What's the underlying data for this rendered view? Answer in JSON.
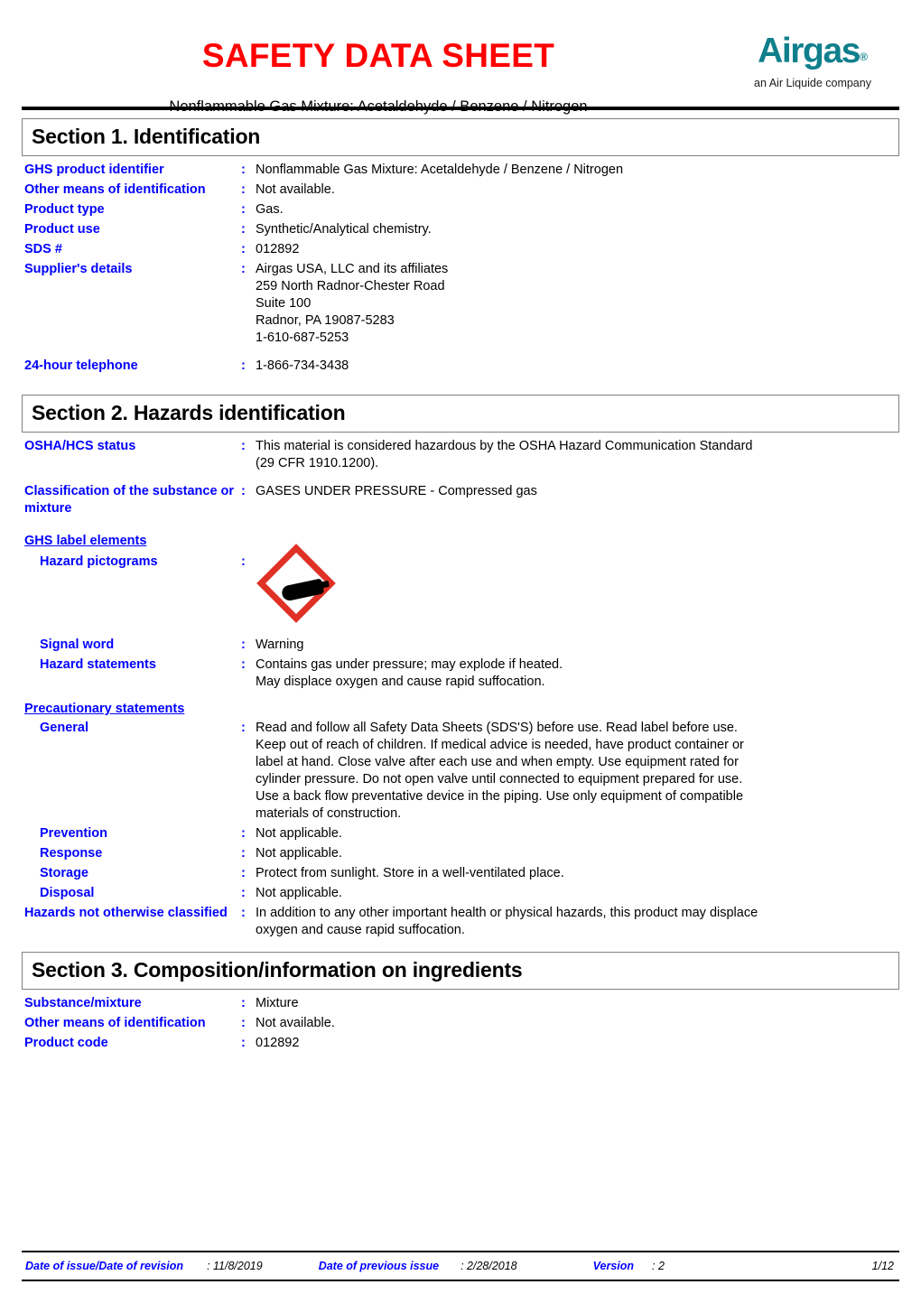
{
  "header": {
    "title": "SAFETY DATA SHEET",
    "subtitle": "Nonflammable Gas Mixture:  Acetaldehyde / Benzene / Nitrogen",
    "logo_word": "Airgas",
    "logo_mark": "®",
    "logo_tagline": "an Air Liquide company",
    "brand_color": "#0f7f8c",
    "title_color": "#ff0000"
  },
  "colon": ":",
  "section1": {
    "heading": "Section 1. Identification",
    "rows": [
      {
        "label": "GHS product identifier",
        "value": "Nonflammable Gas Mixture:  Acetaldehyde / Benzene / Nitrogen"
      },
      {
        "label": "Other means of\nidentification",
        "value": "Not available."
      },
      {
        "label": "Product type",
        "value": "Gas."
      },
      {
        "label": "Product use",
        "value": "Synthetic/Analytical chemistry."
      },
      {
        "label": "SDS #",
        "value": "012892"
      },
      {
        "label": "Supplier's details",
        "value": "Airgas USA, LLC and its affiliates\n259 North Radnor-Chester Road\nSuite 100\nRadnor, PA 19087-5283\n1-610-687-5253"
      },
      {
        "label": "24-hour telephone",
        "value": "1-866-734-3438"
      }
    ]
  },
  "section2": {
    "heading": "Section 2. Hazards identification",
    "osha_label": "OSHA/HCS status",
    "osha_value": "This material is considered hazardous by the OSHA Hazard Communication Standard\n(29 CFR 1910.1200).",
    "classification_label": "Classification of the\nsubstance or mixture",
    "classification_value": "GASES UNDER PRESSURE - Compressed gas",
    "ghs_label_elements": "GHS label elements",
    "pictograms_label": "Hazard pictograms",
    "pictogram_name": "gas-cylinder-pictogram",
    "signal_word_label": "Signal word",
    "signal_word_value": "Warning",
    "hazard_statements_label": "Hazard statements",
    "hazard_statements_value": "Contains gas under pressure; may explode if heated.\nMay displace oxygen and cause rapid suffocation.",
    "precautionary_heading": "Precautionary statements",
    "precautionary": [
      {
        "label": "General",
        "value": "Read and follow all Safety Data Sheets (SDS'S) before use.  Read label before use.\nKeep out of reach of children.  If medical advice is needed, have product container or\nlabel at hand.  Close valve after each use and when empty.  Use equipment rated for\ncylinder pressure.  Do not open valve until connected to equipment prepared for use.\nUse a back flow preventative device in the piping.  Use only equipment of compatible\nmaterials of construction."
      },
      {
        "label": "Prevention",
        "value": "Not applicable."
      },
      {
        "label": "Response",
        "value": "Not applicable."
      },
      {
        "label": "Storage",
        "value": "Protect from sunlight.  Store in a well-ventilated place."
      },
      {
        "label": "Disposal",
        "value": "Not applicable."
      }
    ],
    "hnoc_label": "Hazards not otherwise\nclassified",
    "hnoc_value": "In addition to any other important health or physical hazards, this product may displace\noxygen and cause rapid suffocation."
  },
  "section3": {
    "heading": "Section 3. Composition/information on ingredients",
    "rows": [
      {
        "label": "Substance/mixture",
        "value": "Mixture"
      },
      {
        "label": "Other means of\nidentification",
        "value": "Not available."
      },
      {
        "label": "Product code",
        "value": "012892"
      }
    ]
  },
  "footer": {
    "issue_label": "Date of issue/Date of revision",
    "issue_value": ": 11/8/2019",
    "previous_label": "Date of previous issue",
    "previous_value": ": 2/28/2018",
    "version_label": "Version",
    "version_value": ": 2",
    "page": "1/12"
  }
}
